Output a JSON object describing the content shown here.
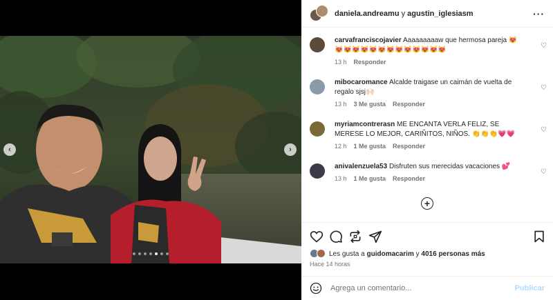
{
  "header": {
    "user1": "daniela.andreamu",
    "separator": "y",
    "user2": "agustin_iglesiasm",
    "more_icon": "more-horizontal-icon"
  },
  "media": {
    "prev_icon": "chevron-left-icon",
    "next_icon": "chevron-right-icon",
    "slide_count": 7,
    "active_slide": 4
  },
  "comments": [
    {
      "user": "carvafranciscojavier",
      "text": "Aaaaaaaaaw que hermosa pareja 😻😻😻😻😻😻😻😻😻😻😻😻😻😻",
      "time": "13 h",
      "likes": "",
      "reply": "Responder",
      "avatar_color": "#5a4a3a"
    },
    {
      "user": "mibocaromance",
      "text": "Alcalde traigase un caimán de vuelta de regalo sjsj🙌🏻",
      "time": "13 h",
      "likes": "3 Me gusta",
      "reply": "Responder",
      "avatar_color": "#8a9aa8"
    },
    {
      "user": "myriamcontrerasn",
      "text": "ME ENCANTA VERLA FELIZ, SE MERESE LO MEJOR, CARIÑITOS, NIÑOS. 👏👏👏💗💗",
      "time": "12 h",
      "likes": "1 Me gusta",
      "reply": "Responder",
      "avatar_color": "#7a6a3a"
    },
    {
      "user": "anivalenzuela53",
      "text": "Disfruten sus merecidas vacaciones 💕",
      "time": "13 h",
      "likes": "1 Me gusta",
      "reply": "Responder",
      "avatar_color": "#3a3a4a"
    }
  ],
  "load_more_icon": "plus-circle-icon",
  "actions": {
    "like_icon": "heart-icon",
    "comment_icon": "comment-icon",
    "repost_icon": "repost-icon",
    "share_icon": "send-icon",
    "save_icon": "bookmark-icon"
  },
  "likes": {
    "prefix": "Les gusta a",
    "user": "guidomacarim",
    "connector": "y",
    "count": "4016 personas más"
  },
  "posted": "Hace 14 horas",
  "add_comment": {
    "placeholder": "Agrega un comentario...",
    "publish": "Publicar",
    "emoji_icon": "emoji-icon"
  }
}
